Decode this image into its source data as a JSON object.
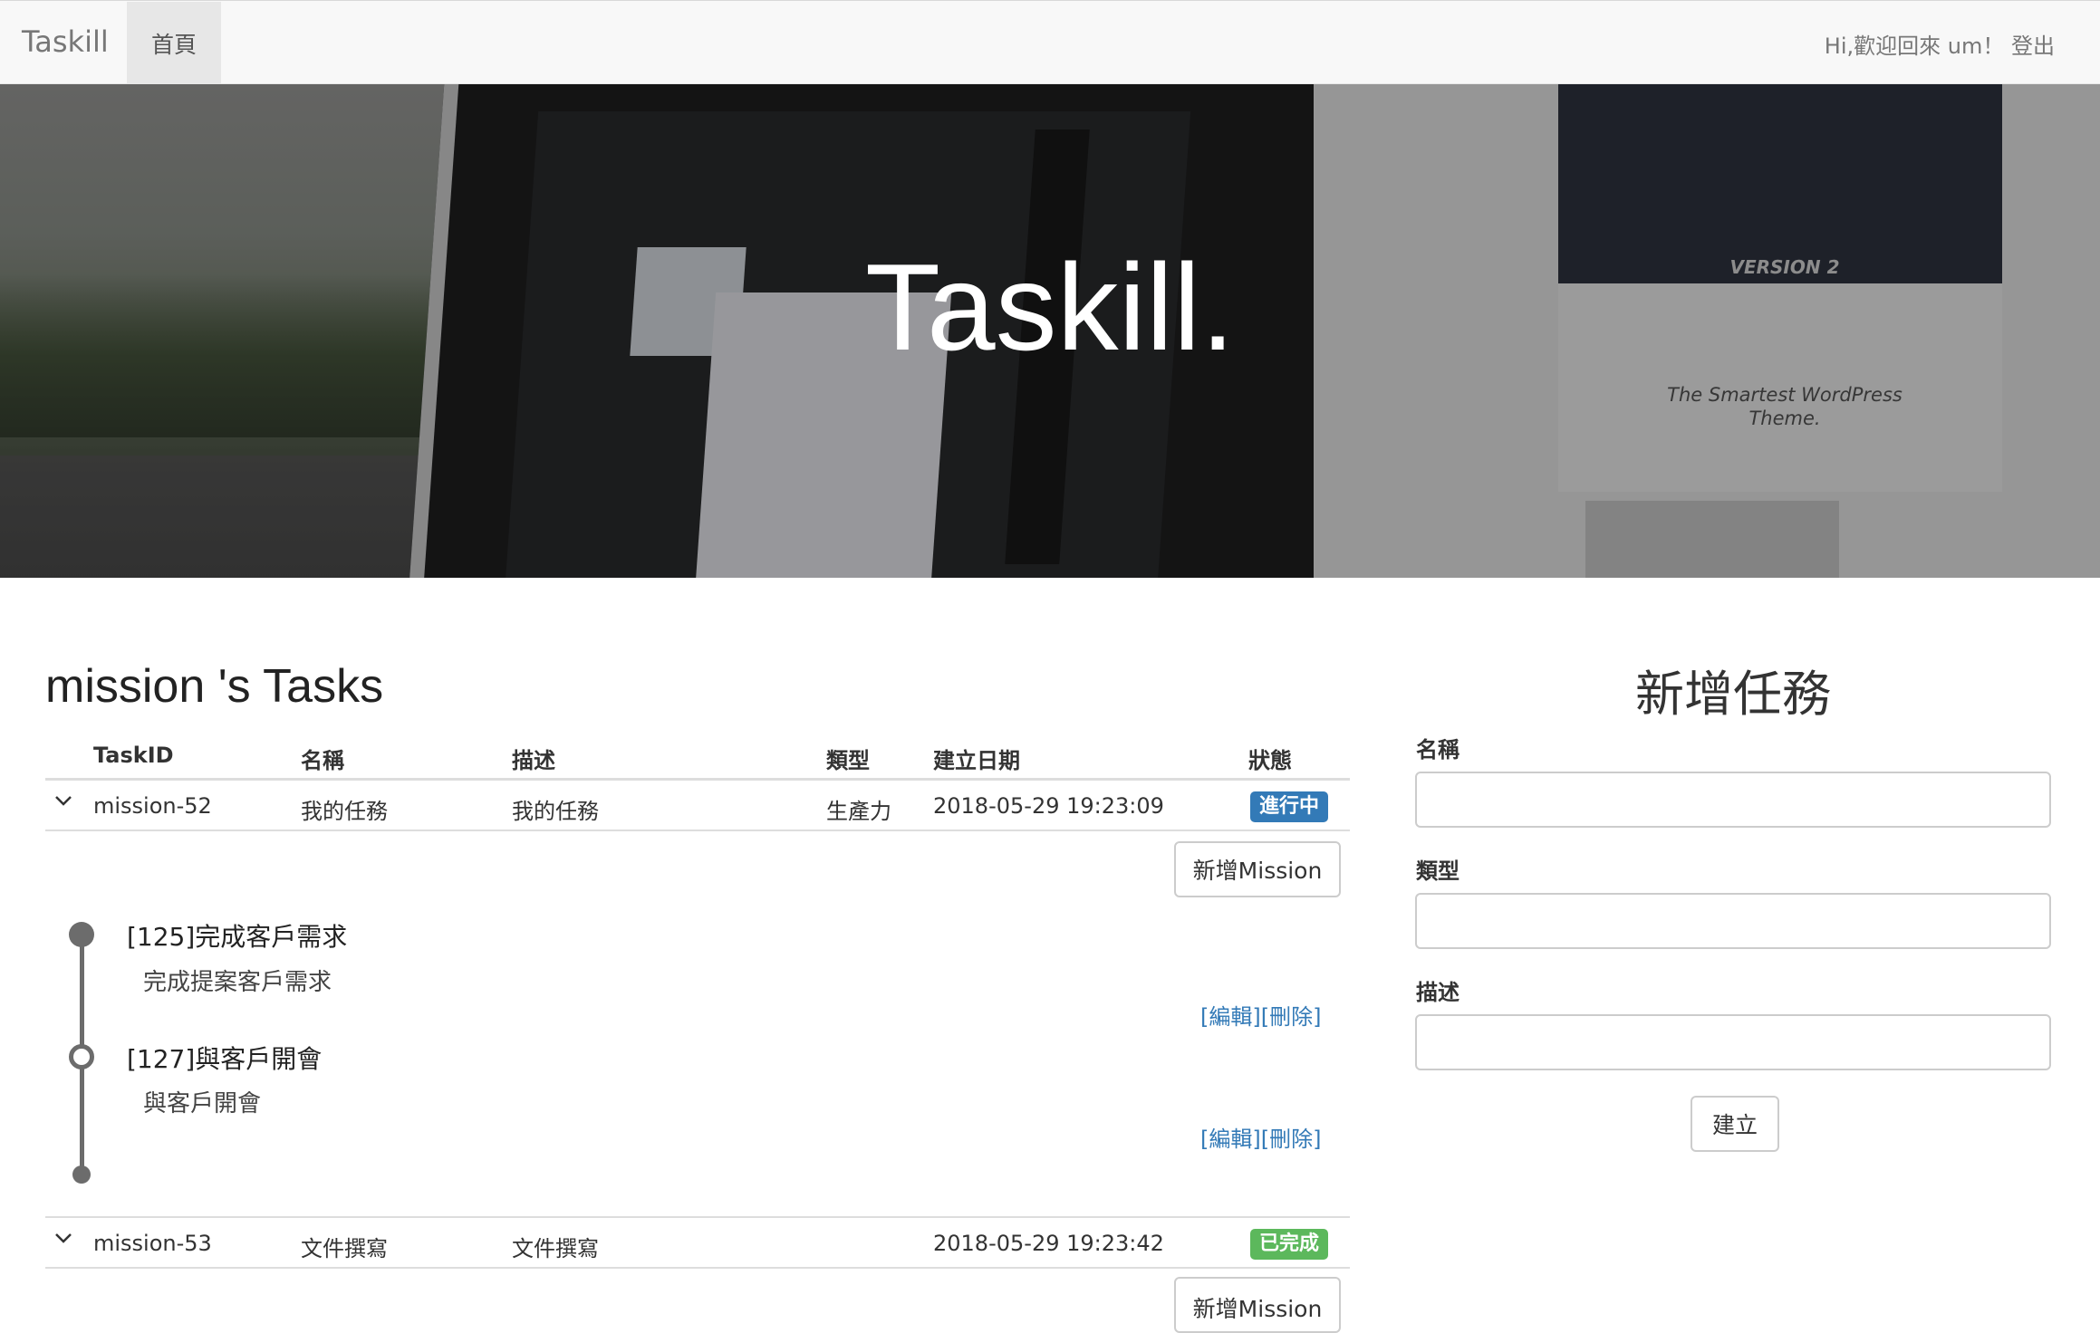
{
  "navbar": {
    "brand": "Taskill",
    "home": "首頁",
    "greeting": "Hi,歡迎回來 um！",
    "logout": "登出"
  },
  "hero": {
    "title": "Taskill.",
    "monitor_tagline": "The Smartest WordPress Theme.",
    "monitor_version": "VERSION 2"
  },
  "tasks": {
    "title": "mission 's Tasks",
    "headers": {
      "id": "TaskID",
      "name": "名稱",
      "desc": "描述",
      "type": "類型",
      "date": "建立日期",
      "status": "狀態"
    },
    "rows": [
      {
        "id": "mission-52",
        "name": "我的任務",
        "desc": "我的任務",
        "type": "生產力",
        "date": "2018-05-29 19:23:09",
        "status": "進行中",
        "status_color": "#337ab7",
        "add_button": "新增Mission",
        "missions": [
          {
            "title": "[125]完成客戶需求",
            "desc": "完成提案客戶需求",
            "edit": "[編輯]",
            "delete": "[刪除]"
          },
          {
            "title": "[127]與客戶開會",
            "desc": "與客戶開會",
            "edit": "[編輯]",
            "delete": "[刪除]"
          }
        ]
      },
      {
        "id": "mission-53",
        "name": "文件撰寫",
        "desc": "文件撰寫",
        "type": "",
        "date": "2018-05-29 19:23:42",
        "status": "已完成",
        "status_color": "#5cb85c",
        "add_button": "新增Mission"
      }
    ]
  },
  "form": {
    "title": "新增任務",
    "name_label": "名稱",
    "type_label": "類型",
    "desc_label": "描述",
    "submit": "建立"
  }
}
